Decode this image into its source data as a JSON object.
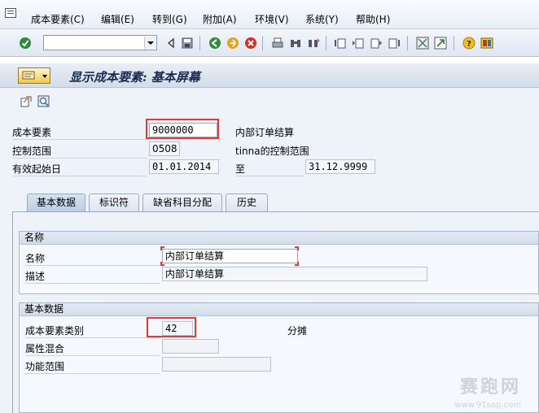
{
  "menu": {
    "items": [
      "成本要素(C)",
      "编辑(E)",
      "转到(G)",
      "附加(A)",
      "环境(V)",
      "系统(Y)",
      "帮助(H)"
    ]
  },
  "toolbar": {
    "icons": [
      "enter-icon",
      "back-icon",
      "save-icon",
      "exit-icon",
      "cancel-icon",
      "print-icon",
      "find-icon",
      "find-next-icon",
      "first-page-icon",
      "prev-page-icon",
      "next-page-icon",
      "last-page-icon",
      "new-session-icon",
      "shortcut-icon",
      "help-icon",
      "layout-icon"
    ]
  },
  "title": {
    "text": "显示成本要素: 基本屏幕"
  },
  "header_fields": {
    "cost_element_label": "成本要素",
    "cost_element_value": "9000000",
    "cost_element_desc": "内部订单结算",
    "controlling_area_label": "控制范围",
    "controlling_area_value": "0508",
    "controlling_area_desc": "tinna的控制范围",
    "valid_from_label": "有效起始日",
    "valid_from_value": "01.01.2014",
    "valid_to_label": "至",
    "valid_to_value": "31.12.9999"
  },
  "tabs": [
    {
      "label": "基本数据",
      "active": true
    },
    {
      "label": "标识符",
      "active": false
    },
    {
      "label": "缺省科目分配",
      "active": false
    },
    {
      "label": "历史",
      "active": false
    }
  ],
  "names_group": {
    "title": "名称",
    "name_label": "名称",
    "name_value": "内部订单结算",
    "desc_label": "描述",
    "desc_value": "内部订单结算"
  },
  "basic_group": {
    "title": "基本数据",
    "category_label": "成本要素类别",
    "category_value": "42",
    "category_desc": "分摊",
    "attr_mix_label": "属性混合",
    "attr_mix_value": "",
    "func_area_label": "功能范围",
    "func_area_value": ""
  },
  "watermark": {
    "text": "赛跑网",
    "sub": "www.91sap.com"
  }
}
